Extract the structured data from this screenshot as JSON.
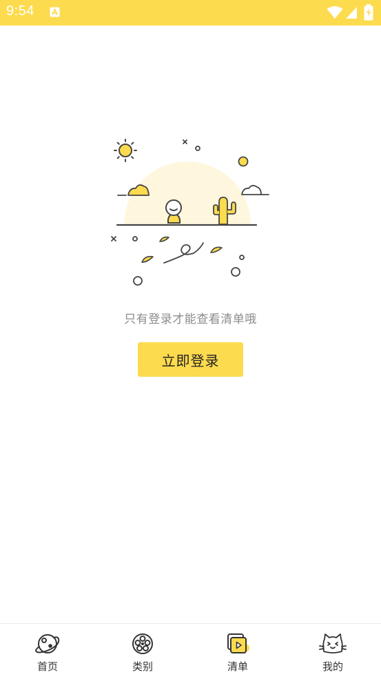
{
  "status_bar": {
    "time": "9:54",
    "background": "#FDDB4E",
    "icons": [
      "app-notification-icon",
      "wifi-icon",
      "signal-icon",
      "battery-charging-icon"
    ]
  },
  "empty_state": {
    "message": "只有登录才能查看清单哦",
    "illustration": "desert-sun-cactus-illustration"
  },
  "login_button": {
    "label": "立即登录",
    "color": "#FDDB4E"
  },
  "tab_bar": {
    "items": [
      {
        "label": "首页",
        "icon": "planet-icon"
      },
      {
        "label": "类别",
        "icon": "film-reel-icon"
      },
      {
        "label": "清单",
        "icon": "playlist-icon",
        "active": true
      },
      {
        "label": "我的",
        "icon": "cat-face-icon"
      }
    ],
    "accent": "#FDDB4E"
  }
}
